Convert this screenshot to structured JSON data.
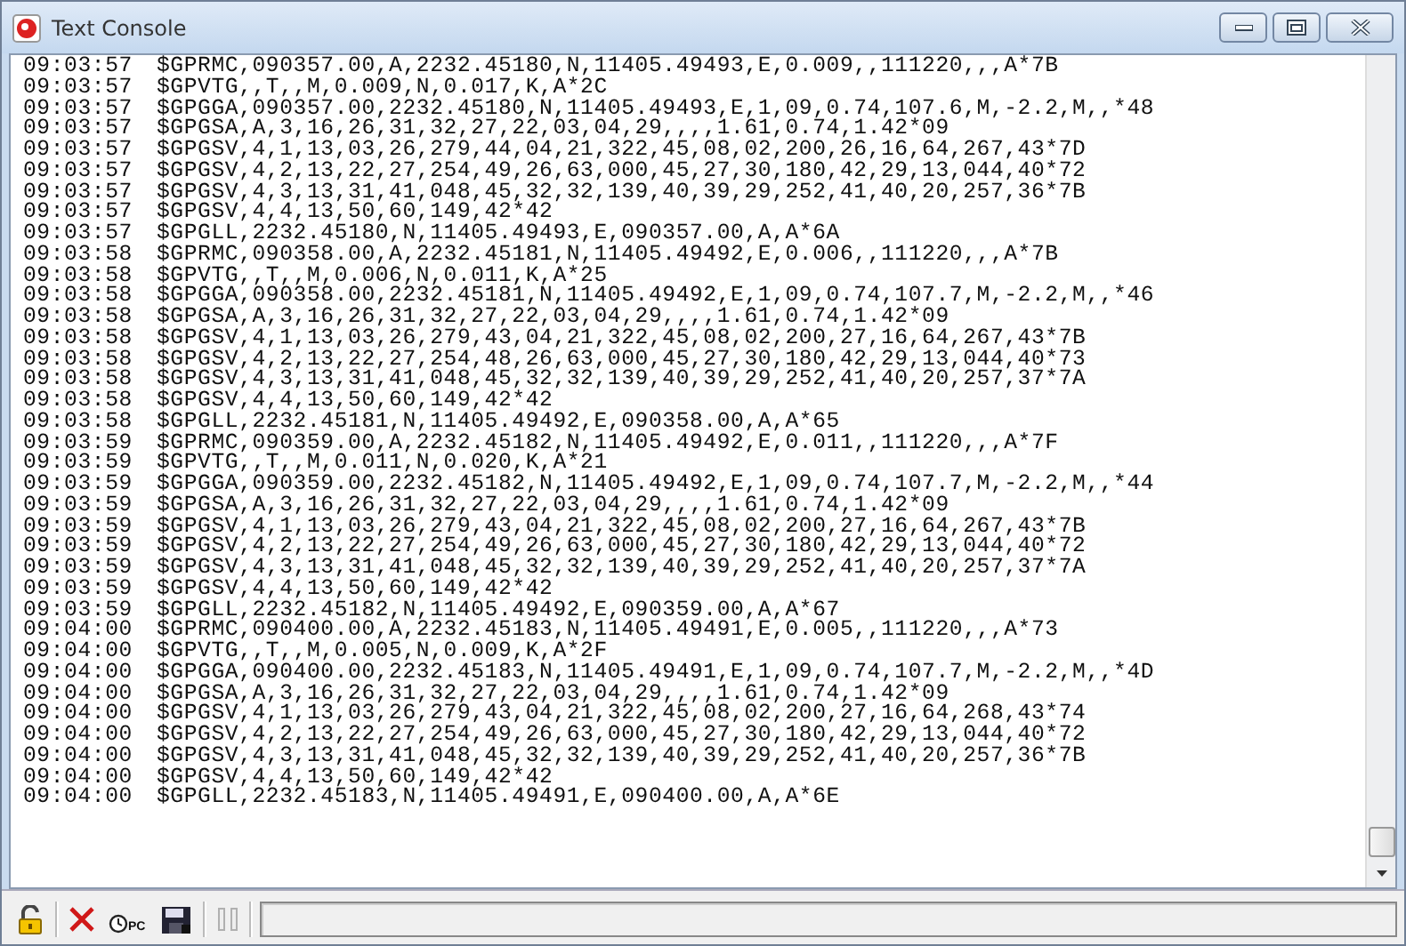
{
  "window": {
    "title": "Text Console"
  },
  "lines": [
    {
      "time": "09:03:57",
      "text": "$GPRMC,090357.00,A,2232.45180,N,11405.49493,E,0.009,,111220,,,A*7B"
    },
    {
      "time": "09:03:57",
      "text": "$GPVTG,,T,,M,0.009,N,0.017,K,A*2C"
    },
    {
      "time": "09:03:57",
      "text": "$GPGGA,090357.00,2232.45180,N,11405.49493,E,1,09,0.74,107.6,M,-2.2,M,,*48"
    },
    {
      "time": "09:03:57",
      "text": "$GPGSA,A,3,16,26,31,32,27,22,03,04,29,,,,1.61,0.74,1.42*09"
    },
    {
      "time": "09:03:57",
      "text": "$GPGSV,4,1,13,03,26,279,44,04,21,322,45,08,02,200,26,16,64,267,43*7D"
    },
    {
      "time": "09:03:57",
      "text": "$GPGSV,4,2,13,22,27,254,49,26,63,000,45,27,30,180,42,29,13,044,40*72"
    },
    {
      "time": "09:03:57",
      "text": "$GPGSV,4,3,13,31,41,048,45,32,32,139,40,39,29,252,41,40,20,257,36*7B"
    },
    {
      "time": "09:03:57",
      "text": "$GPGSV,4,4,13,50,60,149,42*42"
    },
    {
      "time": "09:03:57",
      "text": "$GPGLL,2232.45180,N,11405.49493,E,090357.00,A,A*6A"
    },
    {
      "time": "09:03:58",
      "text": "$GPRMC,090358.00,A,2232.45181,N,11405.49492,E,0.006,,111220,,,A*7B"
    },
    {
      "time": "09:03:58",
      "text": "$GPVTG,,T,,M,0.006,N,0.011,K,A*25"
    },
    {
      "time": "09:03:58",
      "text": "$GPGGA,090358.00,2232.45181,N,11405.49492,E,1,09,0.74,107.7,M,-2.2,M,,*46"
    },
    {
      "time": "09:03:58",
      "text": "$GPGSA,A,3,16,26,31,32,27,22,03,04,29,,,,1.61,0.74,1.42*09"
    },
    {
      "time": "09:03:58",
      "text": "$GPGSV,4,1,13,03,26,279,43,04,21,322,45,08,02,200,27,16,64,267,43*7B"
    },
    {
      "time": "09:03:58",
      "text": "$GPGSV,4,2,13,22,27,254,48,26,63,000,45,27,30,180,42,29,13,044,40*73"
    },
    {
      "time": "09:03:58",
      "text": "$GPGSV,4,3,13,31,41,048,45,32,32,139,40,39,29,252,41,40,20,257,37*7A"
    },
    {
      "time": "09:03:58",
      "text": "$GPGSV,4,4,13,50,60,149,42*42"
    },
    {
      "time": "09:03:58",
      "text": "$GPGLL,2232.45181,N,11405.49492,E,090358.00,A,A*65"
    },
    {
      "time": "09:03:59",
      "text": "$GPRMC,090359.00,A,2232.45182,N,11405.49492,E,0.011,,111220,,,A*7F"
    },
    {
      "time": "09:03:59",
      "text": "$GPVTG,,T,,M,0.011,N,0.020,K,A*21"
    },
    {
      "time": "09:03:59",
      "text": "$GPGGA,090359.00,2232.45182,N,11405.49492,E,1,09,0.74,107.7,M,-2.2,M,,*44"
    },
    {
      "time": "09:03:59",
      "text": "$GPGSA,A,3,16,26,31,32,27,22,03,04,29,,,,1.61,0.74,1.42*09"
    },
    {
      "time": "09:03:59",
      "text": "$GPGSV,4,1,13,03,26,279,43,04,21,322,45,08,02,200,27,16,64,267,43*7B"
    },
    {
      "time": "09:03:59",
      "text": "$GPGSV,4,2,13,22,27,254,49,26,63,000,45,27,30,180,42,29,13,044,40*72"
    },
    {
      "time": "09:03:59",
      "text": "$GPGSV,4,3,13,31,41,048,45,32,32,139,40,39,29,252,41,40,20,257,37*7A"
    },
    {
      "time": "09:03:59",
      "text": "$GPGSV,4,4,13,50,60,149,42*42"
    },
    {
      "time": "09:03:59",
      "text": "$GPGLL,2232.45182,N,11405.49492,E,090359.00,A,A*67"
    },
    {
      "time": "09:04:00",
      "text": "$GPRMC,090400.00,A,2232.45183,N,11405.49491,E,0.005,,111220,,,A*73"
    },
    {
      "time": "09:04:00",
      "text": "$GPVTG,,T,,M,0.005,N,0.009,K,A*2F"
    },
    {
      "time": "09:04:00",
      "text": "$GPGGA,090400.00,2232.45183,N,11405.49491,E,1,09,0.74,107.7,M,-2.2,M,,*4D"
    },
    {
      "time": "09:04:00",
      "text": "$GPGSA,A,3,16,26,31,32,27,22,03,04,29,,,,1.61,0.74,1.42*09"
    },
    {
      "time": "09:04:00",
      "text": "$GPGSV,4,1,13,03,26,279,43,04,21,322,45,08,02,200,27,16,64,268,43*74"
    },
    {
      "time": "09:04:00",
      "text": "$GPGSV,4,2,13,22,27,254,49,26,63,000,45,27,30,180,42,29,13,044,40*72"
    },
    {
      "time": "09:04:00",
      "text": "$GPGSV,4,3,13,31,41,048,45,32,32,139,40,39,29,252,41,40,20,257,36*7B"
    },
    {
      "time": "09:04:00",
      "text": "$GPGSV,4,4,13,50,60,149,42*42"
    },
    {
      "time": "09:04:00",
      "text": "$GPGLL,2232.45183,N,11405.49491,E,090400.00,A,A*6E"
    }
  ],
  "toolbar": [
    {
      "kind": "lock",
      "disabled": false
    },
    {
      "kind": "clear",
      "disabled": false
    },
    {
      "kind": "clock",
      "label": "PC",
      "disabled": false
    },
    {
      "kind": "save",
      "disabled": false
    },
    {
      "kind": "pause",
      "disabled": true
    }
  ]
}
